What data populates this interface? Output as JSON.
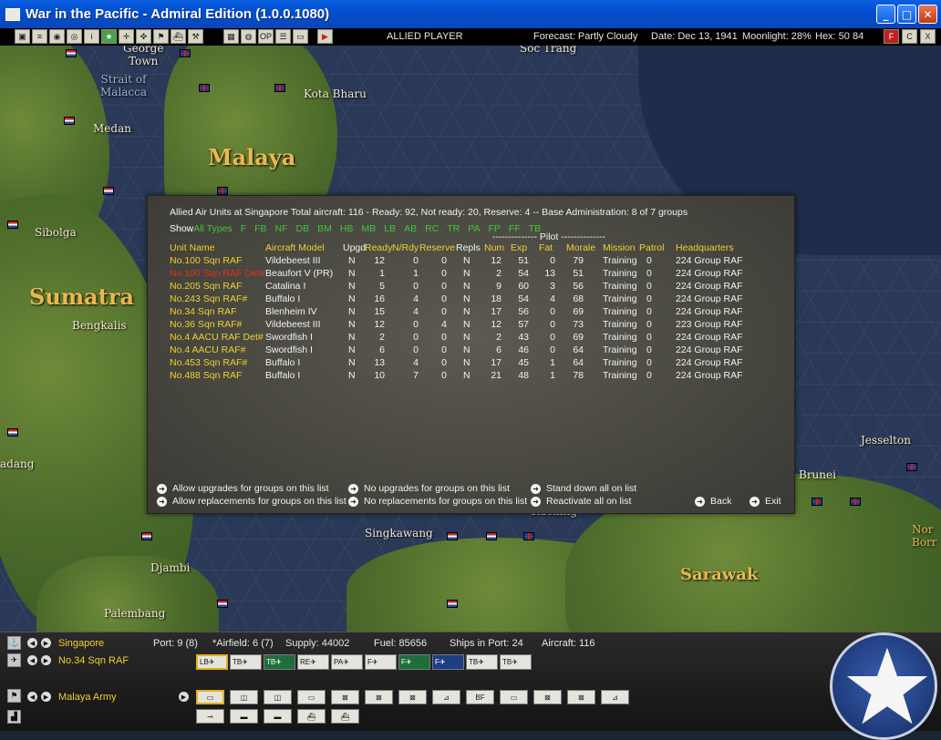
{
  "window": {
    "title": "War in the Pacific - Admiral Edition (1.0.0.1080)",
    "minimize": "_",
    "maximize": "□",
    "close": "✕"
  },
  "toolbar": {
    "player": "ALLIED PLAYER",
    "forecast": "Forecast: Partly Cloudy",
    "date": "Date: Dec 13, 1941",
    "moonlight": "Moonlight: 28%",
    "hex": "Hex: 50 84",
    "right_buttons": [
      "F",
      "C",
      "X"
    ]
  },
  "map": {
    "labels": {
      "george_town": "George\nTown",
      "soc_trang": "Soc Trang",
      "strait": "Strait of\nMalacca",
      "kota_bharu": "Kota Bharu",
      "medan": "Medan",
      "malaya": "Malaya",
      "sibolga": "Sibolga",
      "sumatra": "Sumatra",
      "bengkalis": "Bengkalis",
      "adang": "adang",
      "jesselton": "Jesselton",
      "brunei": "Brunei",
      "singkawang": "Singkawang",
      "kuching": "Kuching",
      "djambi": "Djambi",
      "palembang": "Palembang",
      "sarawak": "Sarawak",
      "nor_borr": "Nor\nBorr"
    }
  },
  "panel": {
    "header": "Allied Air Units at Singapore     Total aircraft: 116 - Ready: 92, Not ready: 20, Reserve: 4 -- Base Administration: 8 of 7 groups",
    "show_label": "Show",
    "show_options": [
      "All Types",
      "F",
      "FB",
      "NF",
      "DB",
      "BM",
      "HB",
      "MB",
      "LB",
      "AB",
      "RC",
      "TR",
      "PA",
      "FP",
      "FF",
      "TB"
    ],
    "pilot_header": "-------------- Pilot --------------",
    "columns": [
      "Unit Name",
      "Aircraft Model",
      "Upgd",
      "Ready",
      "N/Rdy",
      "Reserve",
      "Repls",
      "Num",
      "Exp",
      "Fat",
      "Morale",
      "Mission",
      "Patrol",
      "Headquarters"
    ],
    "rows": [
      [
        "No.100 Sqn RAF",
        "Vildebeest III",
        "N",
        "12",
        "0",
        "0",
        "N",
        "12",
        "51",
        "0",
        "79",
        "Training",
        "0",
        "224 Group RAF"
      ],
      [
        "No.100 Sqn RAF Det#",
        "Beaufort V (PR)",
        "N",
        "1",
        "1",
        "0",
        "N",
        "2",
        "54",
        "13",
        "51",
        "Training",
        "0",
        "224 Group RAF"
      ],
      [
        "No.205 Sqn RAF",
        "Catalina I",
        "N",
        "5",
        "0",
        "0",
        "N",
        "9",
        "60",
        "3",
        "56",
        "Training",
        "0",
        "224 Group RAF"
      ],
      [
        "No.243 Sqn RAF#",
        "Buffalo I",
        "N",
        "16",
        "4",
        "0",
        "N",
        "18",
        "54",
        "4",
        "68",
        "Training",
        "0",
        "224 Group RAF"
      ],
      [
        "No.34 Sqn RAF",
        "Blenheim IV",
        "N",
        "15",
        "4",
        "0",
        "N",
        "17",
        "56",
        "0",
        "69",
        "Training",
        "0",
        "224 Group RAF"
      ],
      [
        "No.36 Sqn RAF#",
        "Vildebeest III",
        "N",
        "12",
        "0",
        "4",
        "N",
        "12",
        "57",
        "0",
        "73",
        "Training",
        "0",
        "223 Group RAF"
      ],
      [
        "No.4 AACU RAF Det#",
        "Swordfish I",
        "N",
        "2",
        "0",
        "0",
        "N",
        "2",
        "43",
        "0",
        "69",
        "Training",
        "0",
        "224 Group RAF"
      ],
      [
        "No.4 AACU RAF#",
        "Swordfish I",
        "N",
        "6",
        "0",
        "0",
        "N",
        "6",
        "46",
        "0",
        "64",
        "Training",
        "0",
        "224 Group RAF"
      ],
      [
        "No.453 Sqn RAF#",
        "Buffalo I",
        "N",
        "13",
        "4",
        "0",
        "N",
        "17",
        "45",
        "1",
        "64",
        "Training",
        "0",
        "224 Group RAF"
      ],
      [
        "No.488 Sqn RAF",
        "Buffalo I",
        "N",
        "10",
        "7",
        "0",
        "N",
        "21",
        "48",
        "1",
        "78",
        "Training",
        "0",
        "224 Group RAF"
      ]
    ],
    "red_row_index": 1,
    "footer": {
      "allow_upgrades": "Allow upgrades for groups on this list",
      "allow_replacements": "Allow replacements for groups on this list",
      "no_upgrades": "No upgrades for groups on this list",
      "no_replacements": "No replacements for groups on this list",
      "stand_down": "Stand down all on list",
      "reactivate": "Reactivate all on list",
      "back": "Back",
      "exit": "Exit"
    }
  },
  "bottom": {
    "base_name": "Singapore",
    "port": "Port: 9 (8)",
    "airfield": "*Airfield: 6 (7)",
    "supply": "Supply: 44002",
    "fuel": "Fuel: 85656",
    "ships_in_port": "Ships in Port: 24",
    "aircraft": "Aircraft: 116",
    "air_unit": "No.34 Sqn RAF",
    "army": "Malaya Army",
    "air_buttons": [
      "LB",
      "TB",
      "TB",
      "RE",
      "PA",
      "F",
      "F",
      "F",
      "TB",
      "TB"
    ],
    "group_buttons": [
      "▭",
      "◫",
      "◫",
      "▭",
      "⊠",
      "⊠",
      "⊠",
      "⊿",
      "BF",
      "▭",
      "⊠",
      "⊠",
      "⊿"
    ],
    "facility_buttons": [
      "⊸",
      "▬",
      "▬",
      "⛴",
      "⛴"
    ]
  }
}
